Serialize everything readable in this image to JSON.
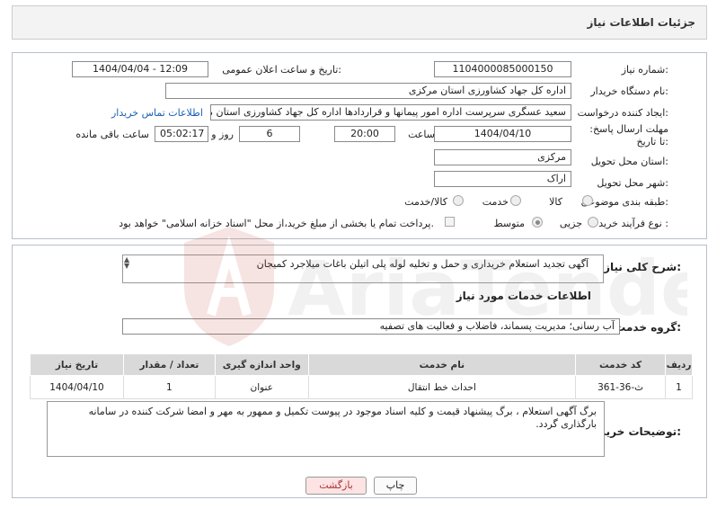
{
  "header": {
    "title": "جزئیات اطلاعات نیاز"
  },
  "fields": {
    "need_number_label": "شماره نیاز:",
    "need_number": "1104000085000150",
    "announce_label": "تاریخ و ساعت اعلان عمومی:",
    "announce_value": "1404/04/04 - 12:09",
    "buyer_org_label": "نام دستگاه خریدار:",
    "buyer_org": "اداره کل جهاد کشاورزی استان مرکزی",
    "creator_label": "ایجاد کننده درخواست:",
    "creator": "سعید عسگری سرپرست اداره امور پیمانها و قراردادها اداره کل جهاد کشاورزی استان مرکزی",
    "contact_link": "اطلاعات تماس خریدار",
    "deadline_label": "مهلت ارسال پاسخ: تا تاریخ:",
    "deadline_date": "1404/04/10",
    "time_label": "ساعت",
    "deadline_time": "20:00",
    "days_value": "6",
    "days_label": "روز و",
    "remaining_time": "05:02:17",
    "remaining_label": "ساعت باقی مانده",
    "province_label": "استان محل تحویل:",
    "province": "مرکزی",
    "city_label": "شهر محل تحویل:",
    "city": "اراک",
    "category_label": "طبقه بندی موضوعی:",
    "category_options": [
      "کالا",
      "خدمت",
      "کالا/خدمت"
    ],
    "process_label": "نوع فرآیند خرید :",
    "process_options": [
      "جزیی",
      "متوسط"
    ],
    "payment_note": "پرداخت تمام یا بخشی از مبلغ خرید،از محل \"اسناد خزانه اسلامی\" خواهد بود."
  },
  "summary": {
    "label": "شرح کلی نیاز:",
    "text": "آگهی تجدید استعلام خریداری و حمل و تخلیه  لوله پلی اتیلن باغات میلاجرد کمیجان"
  },
  "services": {
    "section_title": "اطلاعات خدمات مورد نیاز",
    "group_label": "گروه خدمت:",
    "group_value": "آب رسانی؛ مدیریت پسماند، فاضلاب و فعالیت های تصفیه",
    "columns": [
      "ردیف",
      "کد خدمت",
      "نام خدمت",
      "واحد اندازه گیری",
      "تعداد / مقدار",
      "تاریخ نیاز"
    ],
    "rows": [
      [
        "1",
        "ث-36-361",
        "احداث خط انتقال",
        "عنوان",
        "1",
        "1404/04/10"
      ]
    ]
  },
  "notes": {
    "label": "توضیحات خریدار:",
    "text": "برگ آگهی استعلام ، برگ پیشنهاد قیمت و  کلیه اسناد موجود در پیوست تکمیل و ممهور به مهر و امضا شرکت کننده در سامانه بارگذاری گردد."
  },
  "buttons": {
    "print": "چاپ",
    "back": "بازگشت"
  },
  "watermark": {
    "brand": "AriaTender.neT"
  }
}
